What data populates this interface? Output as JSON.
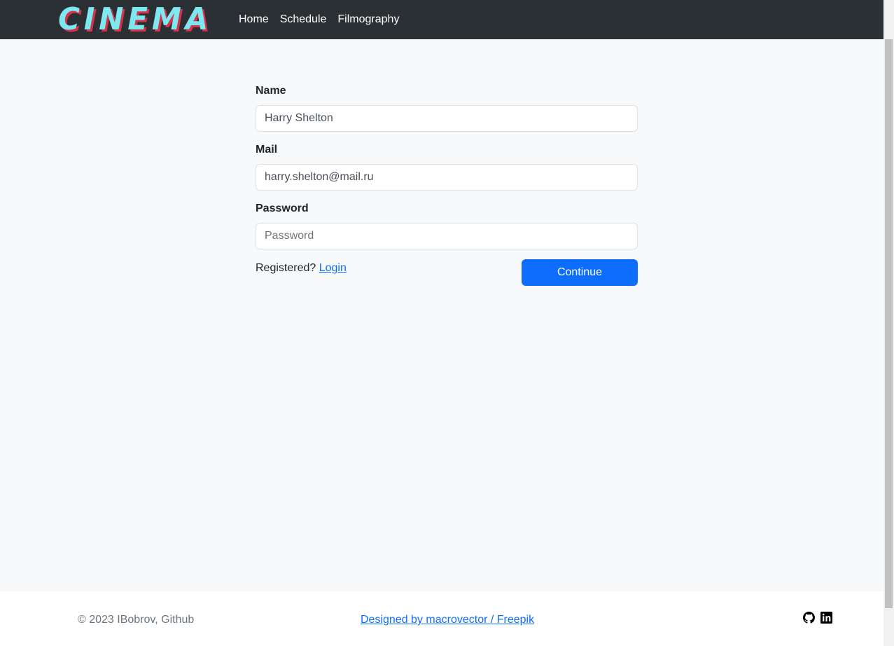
{
  "navbar": {
    "brand": "CINEMA",
    "links": [
      "Home",
      "Schedule",
      "Filmography"
    ]
  },
  "form": {
    "name_label": "Name",
    "name_value": "Harry Shelton",
    "mail_label": "Mail",
    "mail_value": "harry.shelton@mail.ru",
    "password_label": "Password",
    "password_placeholder": "Password",
    "registered_text": "Registered?",
    "login_link": "Login",
    "continue_label": "Continue"
  },
  "footer": {
    "copyright": "© 2023 IBobrov, Github",
    "credit": "Designed by macrovector / Freepik",
    "icons": [
      "github-icon",
      "linkedin-icon"
    ]
  },
  "colors": {
    "navbar_bg": "#2b3035",
    "page_bg": "#f8f9fa",
    "primary": "#0d6efd",
    "logo_cyan": "#7ee8f0",
    "logo_red": "#d8324a"
  }
}
